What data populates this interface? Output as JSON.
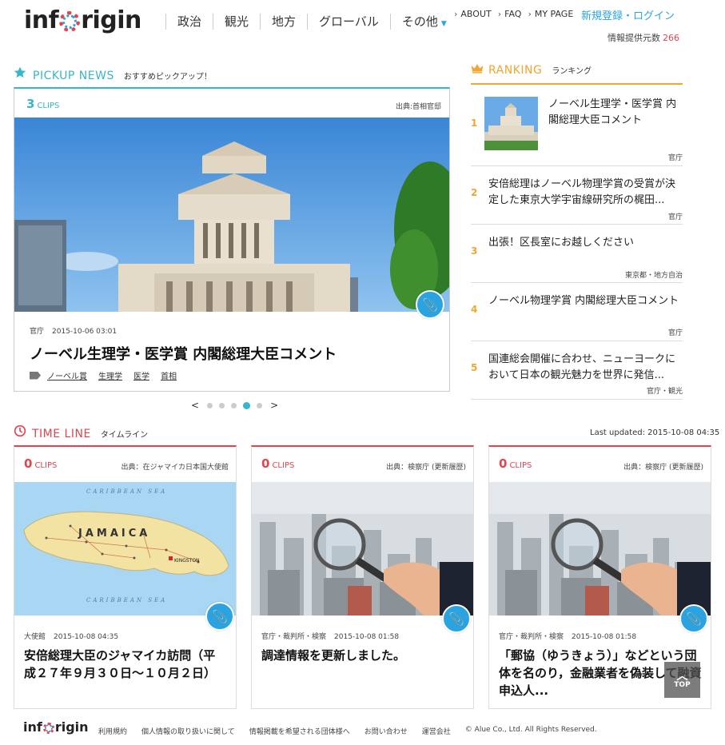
{
  "header": {
    "logo_left": "inf",
    "logo_right": "rigin",
    "nav": [
      "政治",
      "観光",
      "地方",
      "グローバル",
      "その他"
    ],
    "util": [
      "ABOUT",
      "FAQ",
      "MY PAGE"
    ],
    "login": "新規登録・ログイン",
    "info_label": "情報提供元数",
    "info_count": "266"
  },
  "pickup": {
    "title": "PICKUP NEWS",
    "subtitle": "おすすめピックアップ！",
    "clips_count": "3",
    "clips_label": "CLIPS",
    "source": "出典:首相官邸",
    "category": "官庁",
    "date": "2015-10-06 03:01",
    "headline": "ノーベル生理学・医学賞 内閣総理大臣コメント",
    "tags": [
      "ノーベル賞",
      "生理学",
      "医学",
      "首相"
    ],
    "prev": "<",
    "next": ">",
    "active_slide": 4,
    "slide_count": 5
  },
  "ranking": {
    "title": "RANKING",
    "subtitle": "ランキング",
    "items": [
      {
        "num": "1",
        "text": "ノーベル生理学・医学賞 内閣総理大臣コメント",
        "cat": "官庁"
      },
      {
        "num": "2",
        "text": "安倍総理はノーベル物理学賞の受賞が決定した東京大学宇宙線研究所の梶田...",
        "cat": "官庁"
      },
      {
        "num": "3",
        "text": "出張！区長室にお越しください",
        "cat": "東京都・地方自治"
      },
      {
        "num": "4",
        "text": "ノーベル物理学賞 内閣総理大臣コメント",
        "cat": "官庁"
      },
      {
        "num": "5",
        "text": "国連総会開催に合わせ、ニューヨークにおいて日本の観光魅力を世界に発信...",
        "cat": "官庁・観光"
      }
    ]
  },
  "timeline": {
    "title": "TIME LINE",
    "subtitle": "タイムライン",
    "updated": "Last updated: 2015-10-08 04:35",
    "cards": [
      {
        "clips": "0",
        "clips_label": "CLIPS",
        "source": "出典：在ジャマイカ日本国大使館",
        "cat": "大使館",
        "date": "2015-10-08 04:35",
        "title": "安倍総理大臣のジャマイカ訪問（平成２７年９月３０日～１０月２日）",
        "map_country": "JAMAICA",
        "map_city": "KINGSTON",
        "map_sea": "CARIBBEAN SEA"
      },
      {
        "clips": "0",
        "clips_label": "CLIPS",
        "source": "出典：検察庁 (更新履歴)",
        "cat": "官庁・裁判所・検察",
        "date": "2015-10-08 01:58",
        "title": "調達情報を更新しました。"
      },
      {
        "clips": "0",
        "clips_label": "CLIPS",
        "source": "出典：検察庁 (更新履歴)",
        "cat": "官庁・裁判所・検察",
        "date": "2015-10-08 01:58",
        "title": "「郵協（ゆうきょう）」などという団体を名のり，金融業者を偽装して融資申込人..."
      }
    ]
  },
  "top_button": "TOP",
  "footer": {
    "links": [
      "利用規約",
      "個人情報の取り扱いに関して",
      "情報掲載を希望される団体様へ",
      "お問い合わせ",
      "運営会社"
    ],
    "copyright": "© Alue Co., Ltd. All Rights Reserved."
  },
  "colors": {
    "accent_blue": "#2ba3e0",
    "pickup_teal": "#38b6c9",
    "ranking_orange": "#f0a630",
    "timeline_red": "#e2454f"
  }
}
